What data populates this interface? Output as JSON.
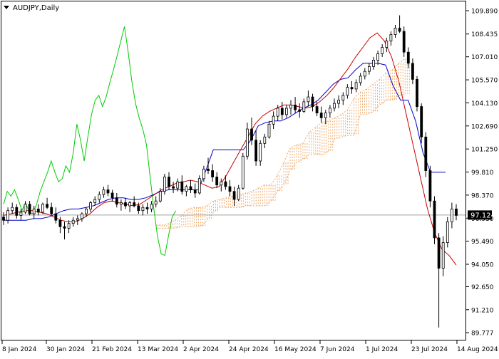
{
  "header": {
    "title": "AUDJPY,Daily"
  },
  "price_label": "97.124",
  "colors": {
    "candle": "#000000",
    "tenkan": "#cc0000",
    "kijun": "#0000cc",
    "chikou": "#00cc00",
    "cloud": "#f0a868",
    "price_line": "#a0a0a0",
    "price_label_bg": "#000000",
    "price_label_text": "#ffffff"
  },
  "chart_data": {
    "type": "candlestick",
    "symbol": "AUDJPY",
    "timeframe": "Daily",
    "ylim": [
      89.777,
      109.89
    ],
    "y_ticks": [
      "109.890",
      "108.435",
      "107.010",
      "105.570",
      "104.130",
      "102.690",
      "101.250",
      "99.810",
      "98.370",
      "96.930",
      "95.490",
      "94.050",
      "92.650",
      "91.210",
      "89.777"
    ],
    "x_ticks": [
      "8 Jan 2024",
      "30 Jan 2024",
      "21 Feb 2024",
      "13 Mar 2024",
      "2 Apr 2024",
      "24 Apr 2024",
      "16 May 2024",
      "7 Jun 2024",
      "1 Jul 2024",
      "23 Jul 2024",
      "14 Aug 2024"
    ],
    "current_price": 97.124,
    "candles": [
      [
        97.0,
        97.3,
        96.5,
        96.8
      ],
      [
        96.8,
        97.6,
        96.6,
        97.4
      ],
      [
        97.4,
        97.9,
        97.2,
        97.6
      ],
      [
        97.6,
        97.8,
        96.9,
        97.1
      ],
      [
        97.1,
        97.5,
        96.8,
        97.3
      ],
      [
        97.3,
        98.0,
        97.2,
        97.8
      ],
      [
        97.8,
        98.0,
        97.1,
        97.2
      ],
      [
        97.2,
        97.7,
        96.9,
        97.5
      ],
      [
        97.5,
        97.8,
        97.1,
        97.3
      ],
      [
        97.3,
        97.9,
        97.2,
        97.8
      ],
      [
        97.8,
        98.2,
        97.5,
        97.6
      ],
      [
        97.6,
        97.9,
        97.1,
        97.2
      ],
      [
        97.2,
        97.6,
        96.6,
        96.8
      ],
      [
        96.8,
        97.0,
        96.0,
        96.4
      ],
      [
        96.4,
        96.7,
        95.6,
        96.3
      ],
      [
        96.3,
        96.8,
        96.0,
        96.6
      ],
      [
        96.6,
        97.0,
        96.4,
        96.8
      ],
      [
        96.8,
        97.1,
        96.5,
        96.9
      ],
      [
        96.9,
        97.3,
        96.7,
        97.2
      ],
      [
        97.2,
        97.6,
        97.0,
        97.5
      ],
      [
        97.5,
        98.0,
        97.3,
        97.9
      ],
      [
        97.9,
        98.3,
        97.7,
        98.1
      ],
      [
        98.1,
        98.6,
        97.9,
        98.4
      ],
      [
        98.4,
        98.9,
        98.2,
        98.7
      ],
      [
        98.7,
        99.0,
        98.3,
        98.5
      ],
      [
        98.5,
        98.7,
        98.0,
        98.2
      ],
      [
        98.2,
        98.5,
        97.6,
        97.8
      ],
      [
        97.8,
        98.1,
        97.4,
        97.9
      ],
      [
        97.9,
        98.2,
        97.5,
        97.7
      ],
      [
        97.7,
        98.0,
        97.3,
        97.9
      ],
      [
        97.9,
        98.3,
        97.6,
        97.7
      ],
      [
        97.7,
        97.9,
        97.2,
        97.4
      ],
      [
        97.4,
        97.8,
        97.1,
        97.6
      ],
      [
        97.6,
        97.9,
        97.2,
        97.5
      ],
      [
        97.5,
        98.0,
        97.3,
        97.8
      ],
      [
        97.8,
        98.3,
        97.6,
        98.0
      ],
      [
        98.0,
        98.8,
        97.9,
        98.6
      ],
      [
        98.6,
        99.7,
        98.4,
        99.5
      ],
      [
        99.5,
        99.8,
        98.7,
        98.9
      ],
      [
        98.9,
        99.2,
        98.5,
        98.8
      ],
      [
        98.8,
        99.4,
        98.6,
        99.2
      ],
      [
        99.2,
        99.6,
        98.4,
        98.6
      ],
      [
        98.6,
        99.0,
        98.3,
        98.9
      ],
      [
        98.9,
        99.3,
        98.5,
        98.7
      ],
      [
        98.7,
        99.1,
        98.2,
        98.5
      ],
      [
        98.5,
        99.6,
        98.4,
        99.4
      ],
      [
        99.4,
        100.2,
        99.2,
        100.0
      ],
      [
        100.0,
        100.7,
        99.7,
        99.9
      ],
      [
        99.9,
        100.3,
        99.2,
        99.5
      ],
      [
        99.5,
        99.8,
        98.8,
        99.0
      ],
      [
        99.0,
        99.4,
        98.6,
        99.2
      ],
      [
        99.2,
        99.6,
        98.7,
        98.9
      ],
      [
        98.9,
        99.3,
        98.3,
        98.6
      ],
      [
        98.6,
        98.9,
        97.7,
        98.1
      ],
      [
        98.1,
        99.0,
        98.0,
        98.8
      ],
      [
        98.8,
        101.0,
        98.7,
        100.8
      ],
      [
        100.8,
        102.9,
        100.6,
        102.5
      ],
      [
        102.5,
        103.2,
        101.5,
        101.8
      ],
      [
        101.8,
        102.4,
        100.2,
        100.5
      ],
      [
        100.5,
        101.8,
        100.2,
        101.6
      ],
      [
        101.6,
        102.2,
        101.3,
        102.0
      ],
      [
        102.0,
        103.0,
        101.9,
        102.8
      ],
      [
        102.8,
        103.6,
        102.5,
        103.3
      ],
      [
        103.3,
        104.0,
        103.0,
        103.8
      ],
      [
        103.8,
        104.2,
        103.1,
        103.4
      ],
      [
        103.4,
        104.0,
        103.2,
        103.8
      ],
      [
        103.8,
        104.3,
        103.4,
        104.0
      ],
      [
        104.0,
        104.5,
        103.5,
        103.7
      ],
      [
        103.7,
        104.1,
        103.2,
        103.6
      ],
      [
        103.6,
        104.4,
        103.5,
        104.2
      ],
      [
        104.2,
        104.9,
        103.9,
        104.5
      ],
      [
        104.5,
        104.7,
        103.6,
        103.9
      ],
      [
        103.9,
        104.2,
        103.3,
        103.5
      ],
      [
        103.5,
        103.9,
        102.9,
        103.2
      ],
      [
        103.2,
        103.7,
        102.8,
        103.5
      ],
      [
        103.5,
        104.0,
        103.2,
        103.8
      ],
      [
        103.8,
        104.4,
        103.6,
        104.1
      ],
      [
        104.1,
        104.6,
        103.8,
        104.3
      ],
      [
        104.3,
        104.8,
        104.0,
        104.6
      ],
      [
        104.6,
        105.3,
        104.4,
        105.1
      ],
      [
        105.1,
        105.5,
        104.7,
        105.0
      ],
      [
        105.0,
        105.6,
        104.8,
        105.4
      ],
      [
        105.4,
        106.0,
        105.2,
        105.8
      ],
      [
        105.8,
        106.3,
        105.6,
        106.1
      ],
      [
        106.1,
        106.6,
        105.9,
        106.4
      ],
      [
        106.4,
        107.0,
        106.2,
        106.8
      ],
      [
        106.8,
        107.4,
        106.5,
        107.2
      ],
      [
        107.2,
        107.8,
        107.0,
        107.6
      ],
      [
        107.6,
        108.2,
        107.3,
        108.0
      ],
      [
        108.0,
        108.6,
        107.7,
        108.4
      ],
      [
        108.4,
        109.0,
        108.2,
        108.8
      ],
      [
        108.8,
        109.6,
        108.5,
        108.6
      ],
      [
        108.6,
        108.9,
        107.0,
        107.3
      ],
      [
        107.3,
        107.6,
        106.3,
        106.6
      ],
      [
        106.6,
        106.9,
        105.3,
        105.6
      ],
      [
        105.6,
        105.8,
        103.6,
        103.9
      ],
      [
        103.9,
        104.1,
        101.6,
        102.0
      ],
      [
        102.0,
        102.3,
        99.5,
        99.9
      ],
      [
        99.9,
        100.2,
        97.6,
        98.0
      ],
      [
        98.0,
        98.3,
        95.3,
        95.7
      ],
      [
        95.7,
        96.0,
        90.1,
        93.8
      ],
      [
        93.8,
        95.8,
        93.3,
        95.4
      ],
      [
        95.4,
        97.0,
        95.1,
        96.7
      ],
      [
        96.7,
        97.9,
        96.3,
        97.5
      ],
      [
        97.5,
        97.8,
        96.8,
        97.1
      ]
    ],
    "tenkan": [
      97.1,
      97.2,
      97.3,
      97.4,
      97.4,
      97.3,
      97.2,
      97.0,
      96.8,
      96.7,
      96.7,
      96.9,
      97.2,
      97.6,
      97.9,
      98.0,
      97.9,
      97.8,
      97.7,
      97.8,
      98.1,
      98.4,
      98.7,
      98.9,
      99.1,
      99.2,
      99.3,
      99.2,
      99.0,
      98.8,
      98.9,
      99.6,
      100.4,
      101.2,
      102.0,
      102.8,
      103.3,
      103.6,
      103.8,
      104.0,
      104.0,
      103.9,
      103.8,
      103.9,
      104.2,
      104.6,
      105.1,
      105.7,
      106.3,
      107.0,
      107.6,
      108.2,
      108.5,
      108.0,
      107.0,
      105.5,
      103.5,
      101.5,
      99.5,
      97.5,
      96.0,
      95.0,
      94.6,
      94.0
    ],
    "kijun": [
      96.8,
      96.8,
      96.8,
      96.8,
      96.9,
      96.9,
      97.0,
      97.2,
      97.4,
      97.5,
      97.5,
      97.6,
      97.7,
      97.9,
      98.1,
      98.2,
      98.2,
      98.1,
      98.1,
      98.2,
      98.4,
      98.6,
      98.7,
      98.7,
      98.7,
      98.7,
      98.7,
      99.9,
      101.2,
      101.2,
      101.2,
      101.2,
      101.2,
      101.8,
      102.7,
      102.9,
      103.0,
      103.0,
      103.2,
      103.5,
      103.8,
      104.0,
      104.3,
      104.8,
      105.3,
      105.6,
      105.7,
      106.2,
      106.6,
      106.6,
      106.6,
      106.5,
      105.2,
      104.3,
      104.3,
      103.0,
      101.0,
      99.8,
      99.8,
      99.8
    ],
    "chikou": [
      97.8,
      98.6,
      98.3,
      98.7,
      98.1,
      97.4,
      97.9,
      97.3,
      97.2,
      97.8,
      98.6,
      99.2,
      99.8,
      100.5,
      99.8,
      99.2,
      99.4,
      100.2,
      99.8,
      101.0,
      102.8,
      101.8,
      100.5,
      102.0,
      103.4,
      104.3,
      104.6,
      103.9,
      104.5,
      105.4,
      106.2,
      107.1,
      108.0,
      108.9,
      107.3,
      105.5,
      104.1,
      103.2,
      102.5,
      101.5,
      99.5,
      97.5,
      95.8,
      94.7,
      94.6,
      95.8,
      97.0,
      97.4
    ],
    "cloud_a": [
      96.5,
      96.5,
      96.6,
      96.8,
      97.1,
      97.5,
      97.6,
      97.6,
      97.7,
      98.0,
      98.1,
      98.2,
      98.3,
      98.4,
      98.5,
      98.6,
      98.8,
      99.0,
      99.0,
      99.6,
      100.4,
      101.3,
      101.5,
      101.6,
      102.3,
      102.6,
      102.9,
      103.0,
      103.2,
      103.4,
      103.7,
      104.4,
      104.8,
      105.0,
      105.3,
      105.6,
      106.0,
      106.2,
      106.6,
      106.9
    ],
    "cloud_b": [
      96.3,
      96.3,
      96.3,
      96.3,
      96.4,
      96.4,
      96.4,
      96.4,
      96.8,
      97.3,
      97.6,
      97.6,
      97.6,
      97.6,
      97.7,
      97.7,
      97.7,
      97.7,
      98.0,
      98.6,
      99.0,
      99.9,
      100.4,
      100.6,
      100.9,
      100.9,
      100.9,
      101.1,
      101.9,
      102.0,
      102.1,
      102.1,
      103.4,
      103.4,
      103.6,
      104.0,
      104.3,
      104.3,
      104.6,
      104.7
    ]
  }
}
